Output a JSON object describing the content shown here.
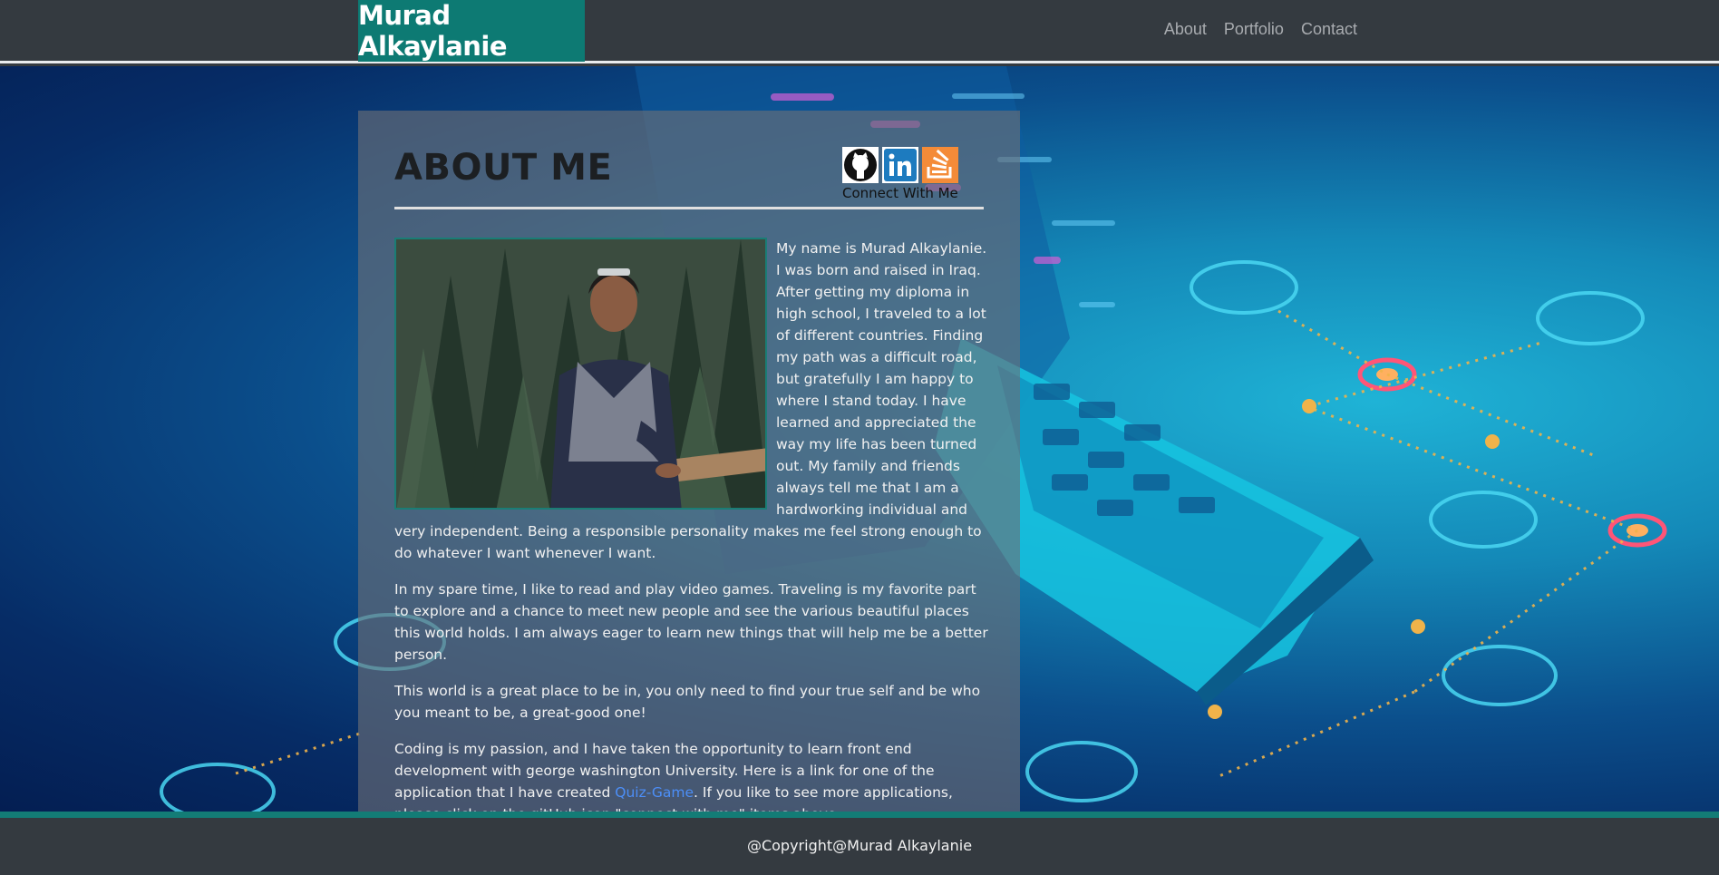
{
  "header": {
    "brand": "Murad Alkaylanie",
    "nav": [
      "About",
      "Portfolio",
      "Contact"
    ]
  },
  "about": {
    "title": "ABOUT ME",
    "connect_label": "Connect With Me",
    "social_icons": [
      "github-icon",
      "linkedin-icon",
      "stackoverflow-icon"
    ],
    "paragraphs": {
      "p1": "My name is Murad Alkaylanie. I was born and raised in Iraq. After getting my diploma in high school, I traveled to a lot of different countries. Finding my path was a difficult road, but gratefully I am happy to where I stand today. I have learned and appreciated the way my life has been turned out. My family and friends always tell me that I am a hardworking individual and very independent. Being a responsible personality makes me feel strong enough to do whatever I want whenever I want.",
      "p2": "In my spare time, I like to read and play video games. Traveling is my favorite part to explore and a chance to meet new people and see the various beautiful places this world holds. I am always eager to learn new things that will help me be a better person.",
      "p3": "This world is a great place to be in, you only need to find your true self and be who you meant to be, a great-good one!",
      "p4_before": "Coding is my passion, and I have taken the opportunity to learn front end development with george washington University. Here is a link for one of the application that I have created ",
      "p4_link": "Quiz-Game",
      "p4_after": ". If you like to see more applications, please click on the gitHub icon \"connect with me\" items above."
    }
  },
  "footer": {
    "copyright": "@Copyright@Murad Alkaylanie"
  },
  "colors": {
    "navbar": "#343a40",
    "brand_bg": "#0d7a73",
    "link": "#4c8ef7",
    "footer_line": "#137c76"
  }
}
